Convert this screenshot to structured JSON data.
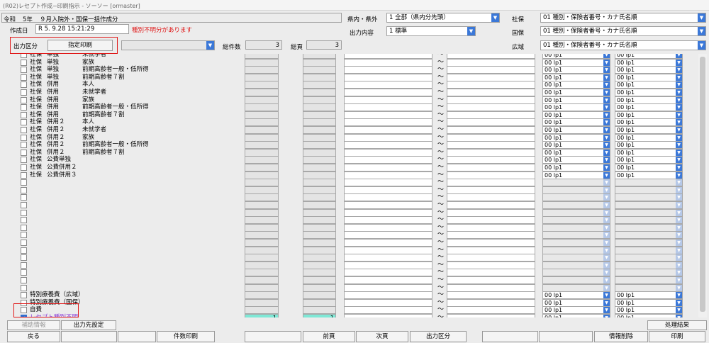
{
  "title": "(R02)レセプト作成−印刷指示 - ソーソー [ormaster]",
  "header": {
    "era": "令和",
    "year": "5年",
    "mode": "９月入院外・国保一括作成分",
    "created_label": "作成日",
    "created_value": "R 5. 9.28 15:21:29",
    "warning": "種別不明分があります",
    "output_class_label": "出力区分",
    "designated_print_button": "指定印刷",
    "output_combo": "",
    "total_count_label": "総件数",
    "total_count": "3",
    "total_pages_label": "総頁",
    "total_pages": "3",
    "pref_label": "県内・県外",
    "pref_value": "1 全部（県内分先頭）",
    "content_label": "出力内容",
    "content_value": "1 標準",
    "shaho_label": "社保",
    "shaho_value": "01 種別・保険者番号・カナ氏名順",
    "kokuho_label": "国保",
    "kokuho_value": "01 種別・保険者番号・カナ氏名順",
    "kouiki_label": "広域",
    "kouiki_value": "01 種別・保険者番号・カナ氏名順"
  },
  "rows": [
    {
      "c1": "社保",
      "c2": "単独",
      "c3": "未就学者",
      "sel1": "00 lp1",
      "sel2": "00 lp1"
    },
    {
      "c1": "社保",
      "c2": "単独",
      "c3": "家族",
      "sel1": "00 lp1",
      "sel2": "00 lp1"
    },
    {
      "c1": "社保",
      "c2": "単独",
      "c3": "前期高齢者一般・低所得",
      "sel1": "00 lp1",
      "sel2": "00 lp1"
    },
    {
      "c1": "社保",
      "c2": "単独",
      "c3": "前期高齢者７割",
      "sel1": "00 lp1",
      "sel2": "00 lp1"
    },
    {
      "c1": "社保",
      "c2": "併用",
      "c3": "本人",
      "sel1": "00 lp1",
      "sel2": "00 lp1"
    },
    {
      "c1": "社保",
      "c2": "併用",
      "c3": "未就学者",
      "sel1": "00 lp1",
      "sel2": "00 lp1"
    },
    {
      "c1": "社保",
      "c2": "併用",
      "c3": "家族",
      "sel1": "00 lp1",
      "sel2": "00 lp1"
    },
    {
      "c1": "社保",
      "c2": "併用",
      "c3": "前期高齢者一般・低所得",
      "sel1": "00 lp1",
      "sel2": "00 lp1"
    },
    {
      "c1": "社保",
      "c2": "併用",
      "c3": "前期高齢者７割",
      "sel1": "00 lp1",
      "sel2": "00 lp1"
    },
    {
      "c1": "社保",
      "c2": "併用２",
      "c3": "本人",
      "sel1": "00 lp1",
      "sel2": "00 lp1"
    },
    {
      "c1": "社保",
      "c2": "併用２",
      "c3": "未就学者",
      "sel1": "00 lp1",
      "sel2": "00 lp1"
    },
    {
      "c1": "社保",
      "c2": "併用２",
      "c3": "家族",
      "sel1": "00 lp1",
      "sel2": "00 lp1"
    },
    {
      "c1": "社保",
      "c2": "併用２",
      "c3": "前期高齢者一般・低所得",
      "sel1": "00 lp1",
      "sel2": "00 lp1"
    },
    {
      "c1": "社保",
      "c2": "併用２",
      "c3": "前期高齢者７割",
      "sel1": "00 lp1",
      "sel2": "00 lp1"
    },
    {
      "c1": "社保",
      "c2": "公費単独",
      "c3": "",
      "sel1": "00 lp1",
      "sel2": "00 lp1"
    },
    {
      "c1": "社保",
      "c2": "公費併用２",
      "c3": "",
      "sel1": "00 lp1",
      "sel2": "00 lp1"
    },
    {
      "c1": "社保",
      "c2": "公費併用３",
      "c3": "",
      "sel1": "00 lp1",
      "sel2": "00 lp1"
    },
    {
      "c1": "",
      "c2": "",
      "c3": "",
      "sel1": "",
      "sel2": ""
    },
    {
      "c1": "",
      "c2": "",
      "c3": "",
      "sel1": "",
      "sel2": ""
    },
    {
      "c1": "",
      "c2": "",
      "c3": "",
      "sel1": "",
      "sel2": ""
    },
    {
      "c1": "",
      "c2": "",
      "c3": "",
      "sel1": "",
      "sel2": ""
    },
    {
      "c1": "",
      "c2": "",
      "c3": "",
      "sel1": "",
      "sel2": ""
    },
    {
      "c1": "",
      "c2": "",
      "c3": "",
      "sel1": "",
      "sel2": ""
    },
    {
      "c1": "",
      "c2": "",
      "c3": "",
      "sel1": "",
      "sel2": ""
    },
    {
      "c1": "",
      "c2": "",
      "c3": "",
      "sel1": "",
      "sel2": ""
    },
    {
      "c1": "",
      "c2": "",
      "c3": "",
      "sel1": "",
      "sel2": ""
    },
    {
      "c1": "",
      "c2": "",
      "c3": "",
      "sel1": "",
      "sel2": ""
    },
    {
      "c1": "",
      "c2": "",
      "c3": "",
      "sel1": "",
      "sel2": ""
    },
    {
      "c1": "",
      "c2": "",
      "c3": "",
      "sel1": "",
      "sel2": ""
    },
    {
      "c1": "",
      "c2": "",
      "c3": "",
      "sel1": "",
      "sel2": ""
    },
    {
      "c1": "",
      "c2": "",
      "c3": "",
      "sel1": "",
      "sel2": ""
    },
    {
      "c1": "",
      "c2": "",
      "c3": "",
      "sel1": "",
      "sel2": ""
    },
    {
      "c1": "特別療養費（広域）",
      "c2": "",
      "c3": "",
      "sel1": "00 lp1",
      "sel2": "00 lp1"
    },
    {
      "c1": "特別療養費（国保）",
      "c2": "",
      "c3": "",
      "sel1": "00 lp1",
      "sel2": "00 lp1"
    },
    {
      "c1": "自費",
      "c2": "",
      "c3": "",
      "sel1": "00 lp1",
      "sel2": "00 lp1"
    },
    {
      "c1": "レセプト種別不明",
      "c2": "",
      "c3": "",
      "sel1": "00 lp1",
      "sel2": "00 lp1",
      "count1": "1",
      "count2": "1",
      "checked": true
    }
  ],
  "tilde": "〜",
  "footer": {
    "detail_info": "補助情報",
    "output_dest": "出力先設定",
    "process_result": "処理結果",
    "buttons": [
      "戻る",
      "",
      "",
      "件数印刷",
      "",
      "前頁",
      "次頁",
      "出力区分",
      "",
      "",
      "情報削除",
      "印刷"
    ]
  }
}
